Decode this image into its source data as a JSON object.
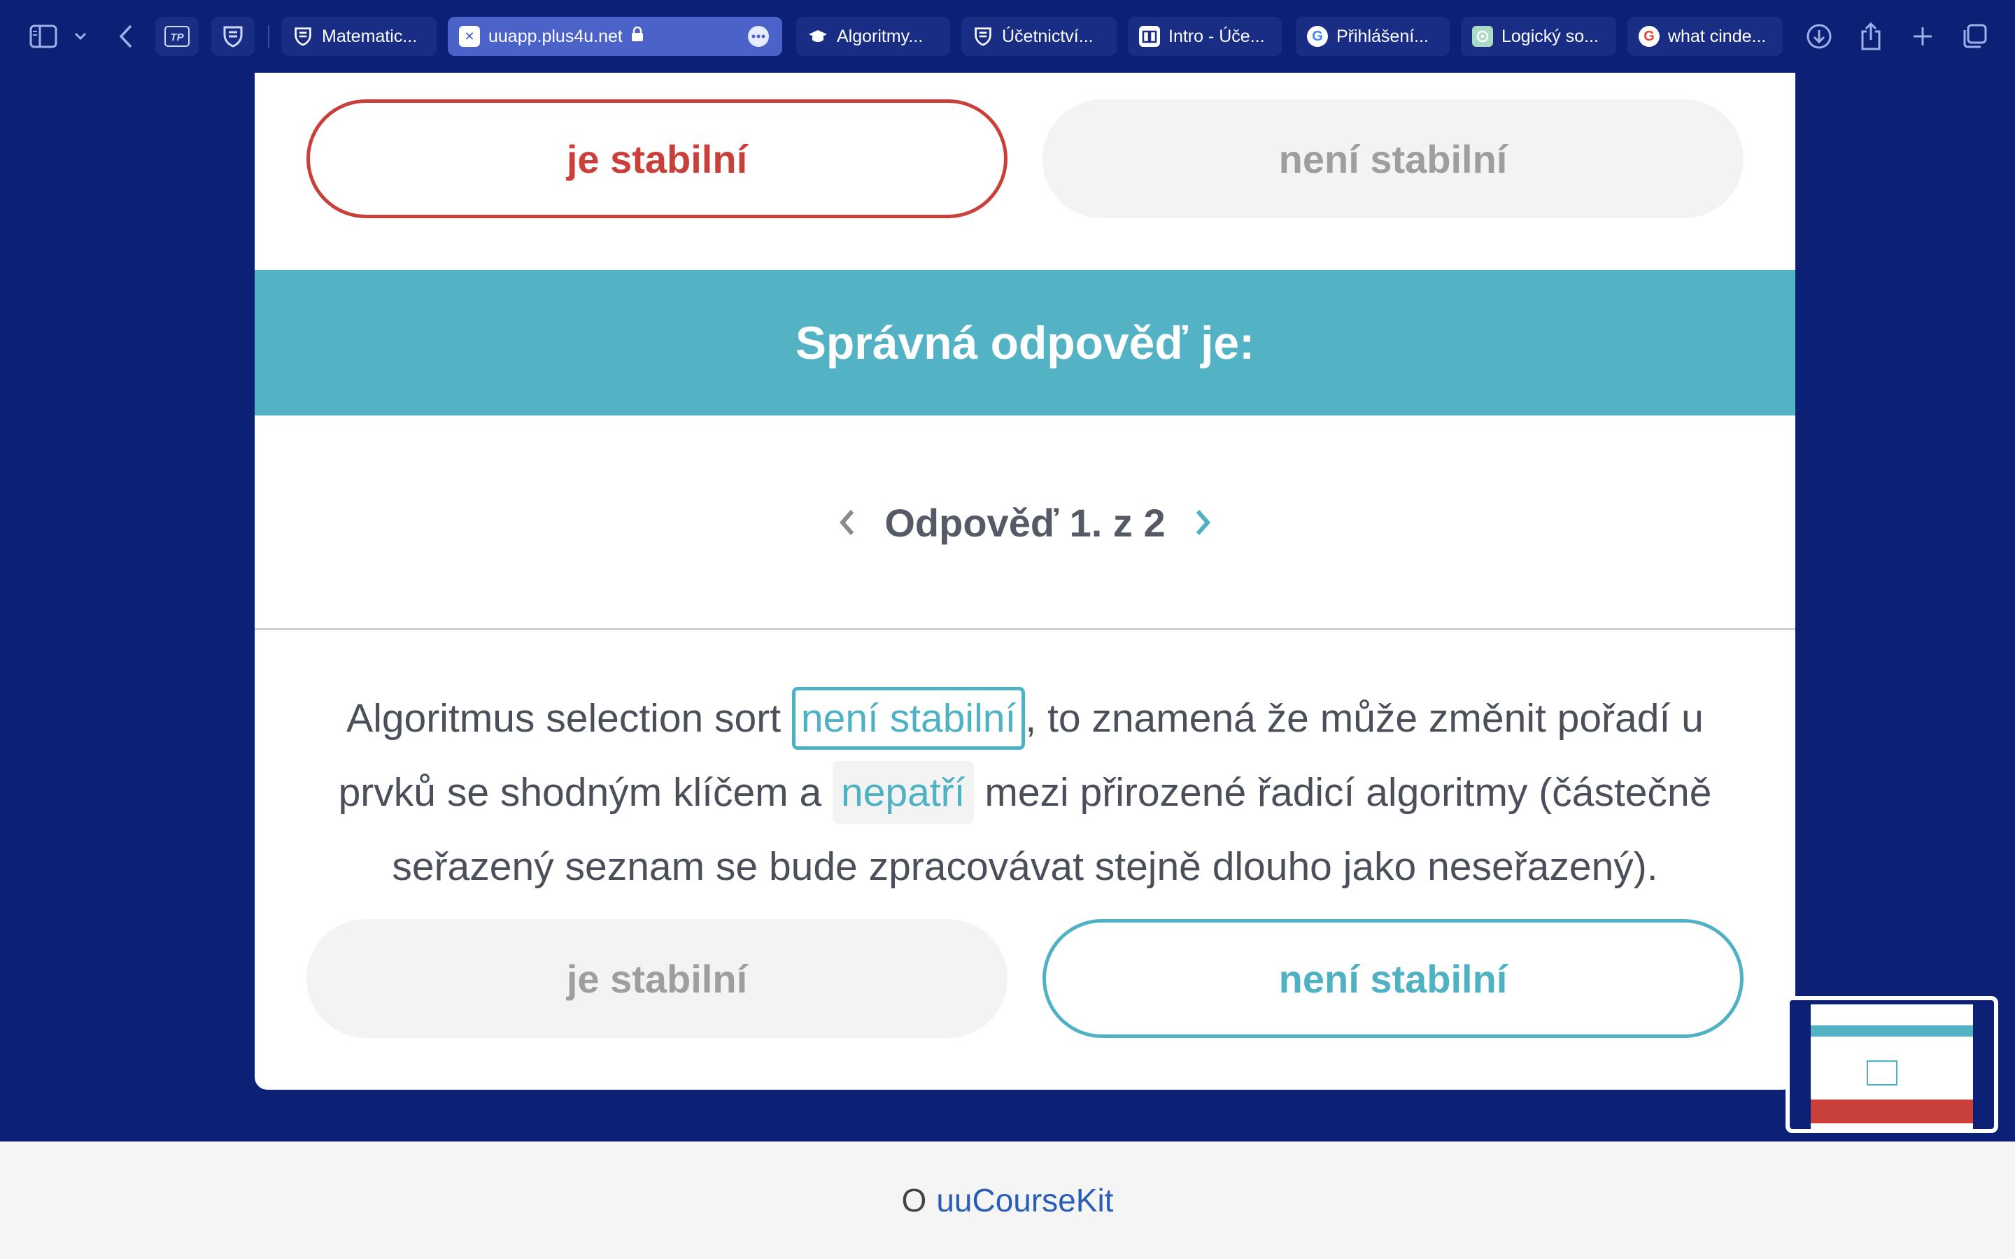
{
  "browser": {
    "tabs": [
      {
        "label": "Matematic...",
        "icon": "shield-icon"
      },
      {
        "label": "uuapp.plus4u.net",
        "icon": "x-square-icon",
        "active": true
      },
      {
        "label": "Algoritmy...",
        "icon": "graduation-cap-icon"
      },
      {
        "label": "Účetnictví...",
        "icon": "shield-icon"
      },
      {
        "label": "Intro - Úče...",
        "icon": "book-icon"
      },
      {
        "label": "Přihlášení...",
        "icon": "google-icon"
      },
      {
        "label": "Logický so...",
        "icon": "openai-icon"
      },
      {
        "label": "what cinde...",
        "icon": "google-icon"
      }
    ],
    "pinned": [
      "TP",
      "shield"
    ]
  },
  "question_top": {
    "option_left": "je stabilní",
    "option_right": "není stabilní"
  },
  "banner": {
    "title": "Správná odpověď je:"
  },
  "pager": {
    "label": "Odpověď 1. z 2"
  },
  "answer": {
    "part1": "Algoritmus selection sort ",
    "blank1": "není stabilní",
    "part2": ", to znamená že může změnit pořadí u prvků se shodným klíčem a ",
    "blank2": "nepatří",
    "part3": " mezi přirozené řadicí algoritmy (částečně seřazený seznam se bude zpracovávat stejně dlouho jako neseřazený)."
  },
  "answer_options": {
    "option_left": "je stabilní",
    "option_right": "není stabilní"
  },
  "footer": {
    "prefix": "O",
    "link": "uuCourseKit"
  },
  "colors": {
    "background": "#0c2175",
    "teal": "#53b3c5",
    "red": "#c9403a"
  }
}
